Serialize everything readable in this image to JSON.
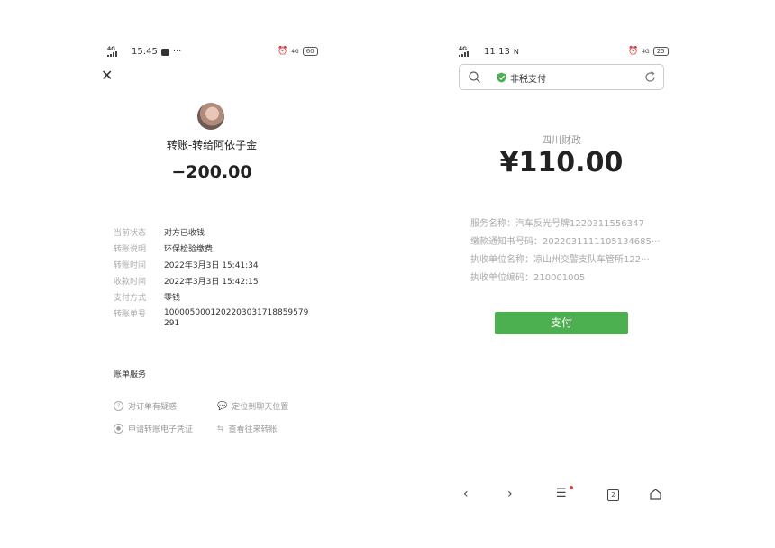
{
  "left": {
    "status": {
      "signal": "4G",
      "time": "15:45",
      "dots": "···",
      "network": "4G",
      "battery": "60"
    },
    "close_icon": "close-icon",
    "title": "转账-转给阿依子金",
    "amount": "−200.00",
    "details": [
      {
        "label": "当前状态",
        "value": "对方已收钱"
      },
      {
        "label": "转账说明",
        "value": "环保检验缴费"
      },
      {
        "label": "转账时间",
        "value": "2022年3月3日 15:41:34"
      },
      {
        "label": "收款时间",
        "value": "2022年3月3日 15:42:15"
      },
      {
        "label": "支付方式",
        "value": "零钱"
      },
      {
        "label": "转账单号",
        "value": "1000050001202203031718859579291"
      }
    ],
    "services_title": "账单服务",
    "services": [
      {
        "label": "对订单有疑惑",
        "icon": "question-icon"
      },
      {
        "label": "定位到聊天位置",
        "icon": "chat-icon"
      },
      {
        "label": "申请转账电子凭证",
        "icon": "target-icon"
      },
      {
        "label": "查看往来转账",
        "icon": "swap-icon"
      }
    ]
  },
  "right": {
    "status": {
      "signal": "4G",
      "time": "11:13",
      "network": "4G",
      "battery": "25"
    },
    "search": {
      "label": "非税支付"
    },
    "org": "四川财政",
    "amount": "¥110.00",
    "fields": [
      {
        "label": "服务名称：",
        "value": "汽车反光号牌1220311556347"
      },
      {
        "label": "缴款通知书号码：",
        "value": "2022031111105134685···"
      },
      {
        "label": "执收单位名称：",
        "value": "凉山州交警支队车管所122···"
      },
      {
        "label": "执收单位编码：",
        "value": "210001005"
      }
    ],
    "pay_label": "支付",
    "nav": {
      "tabs_count": "2"
    },
    "accent": "#4caf50"
  }
}
